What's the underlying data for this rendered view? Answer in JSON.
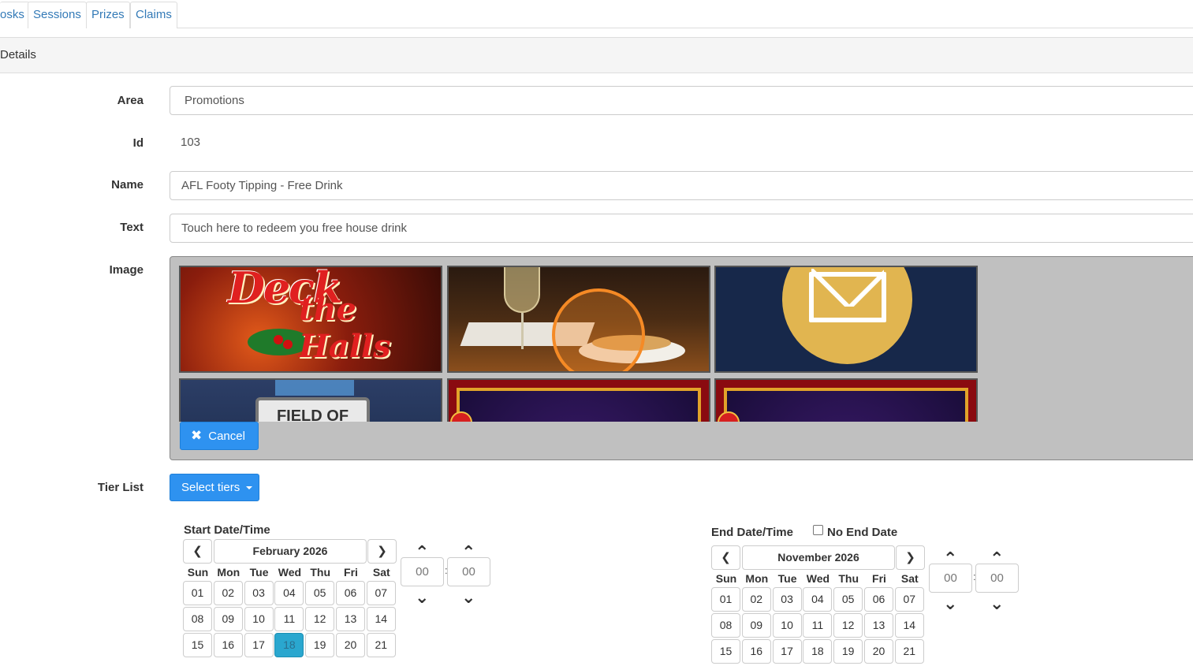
{
  "tabs": [
    "osks",
    "Sessions",
    "Prizes",
    "Claims"
  ],
  "panel": {
    "heading": "Details"
  },
  "form": {
    "area_label": "Area",
    "area_value": "Promotions",
    "id_label": "Id",
    "id_value": "103",
    "name_label": "Name",
    "name_value": "AFL Footy Tipping - Free Drink",
    "text_label": "Text",
    "text_value": "Touch here to redeem you free house drink",
    "image_label": "Image",
    "tier_label": "Tier List"
  },
  "image_picker": {
    "cancel_label": "Cancel",
    "thumb1_title": "Deck",
    "thumb1_sub": "the Halls",
    "thumb4_text": "FIELD OF"
  },
  "tiers": {
    "button_label": "Select tiers"
  },
  "start_picker": {
    "label": "Start Date/Time",
    "month": "February 2026",
    "selected_day": "18",
    "hours": "00",
    "minutes": "00"
  },
  "end_picker": {
    "label": "End Date/Time",
    "no_end_label": "No End Date",
    "no_end_checked": false,
    "month": "November 2026",
    "hours": "00",
    "minutes": "00"
  },
  "weekdays": [
    "Sun",
    "Mon",
    "Tue",
    "Wed",
    "Thu",
    "Fri",
    "Sat"
  ],
  "start_days": [
    [
      "01",
      "02",
      "03",
      "04",
      "05",
      "06",
      "07"
    ],
    [
      "08",
      "09",
      "10",
      "11",
      "12",
      "13",
      "14"
    ],
    [
      "15",
      "16",
      "17",
      "18",
      "19",
      "20",
      "21"
    ]
  ],
  "end_days": [
    [
      "01",
      "02",
      "03",
      "04",
      "05",
      "06",
      "07"
    ],
    [
      "08",
      "09",
      "10",
      "11",
      "12",
      "13",
      "14"
    ],
    [
      "15",
      "16",
      "17",
      "18",
      "19",
      "20",
      "21"
    ]
  ],
  "icons": {
    "prev": "chevron-left-icon",
    "next": "chevron-right-icon",
    "up": "chevron-up-icon",
    "down": "chevron-down-icon",
    "cancel": "times-icon",
    "caret": "caret-down-icon"
  }
}
